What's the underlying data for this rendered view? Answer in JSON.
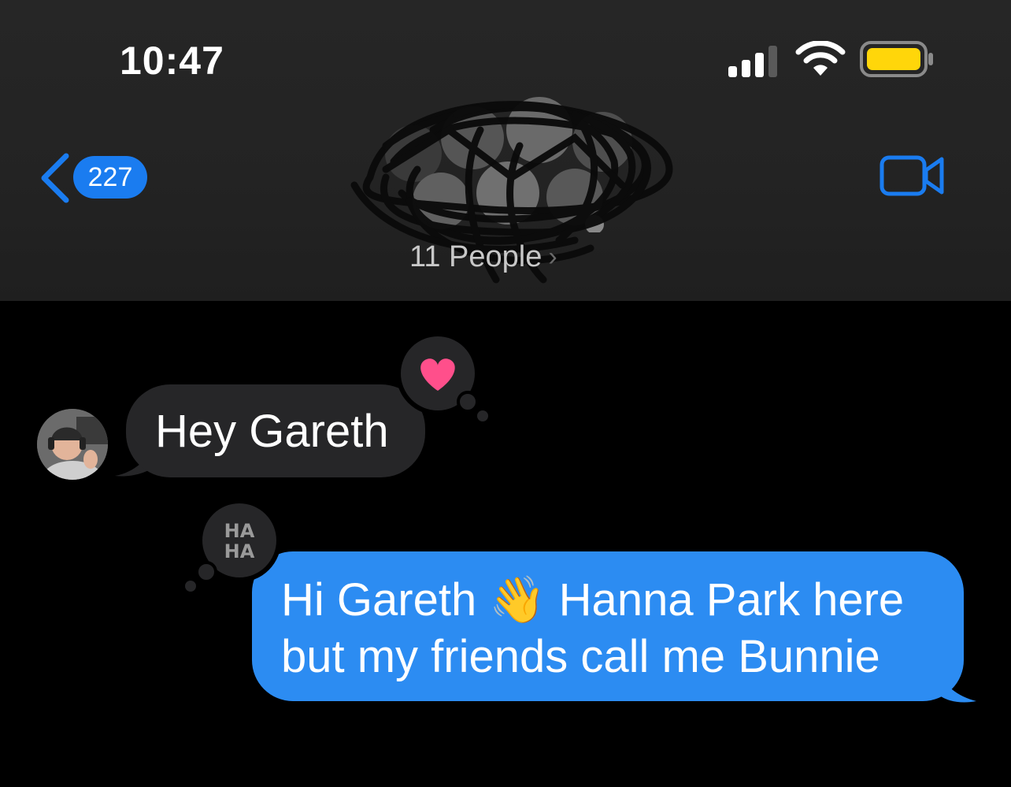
{
  "status_bar": {
    "time": "10:47"
  },
  "nav": {
    "back_count": "227",
    "group_subtitle": "11 People"
  },
  "messages": [
    {
      "direction": "incoming",
      "text": "Hey Gareth",
      "tapback": "heart-icon"
    },
    {
      "direction": "outgoing",
      "text_before": "Hi Gareth",
      "emoji": "👋",
      "text_after": "Hanna Park here but my friends call me Bunnie",
      "tapback": "haha-icon"
    }
  ],
  "colors": {
    "accent": "#1a7cf0",
    "outgoing_bubble": "#2c8cf2",
    "incoming_bubble": "#262628",
    "heart": "#ff4f8b",
    "battery": "#ffd60a"
  }
}
